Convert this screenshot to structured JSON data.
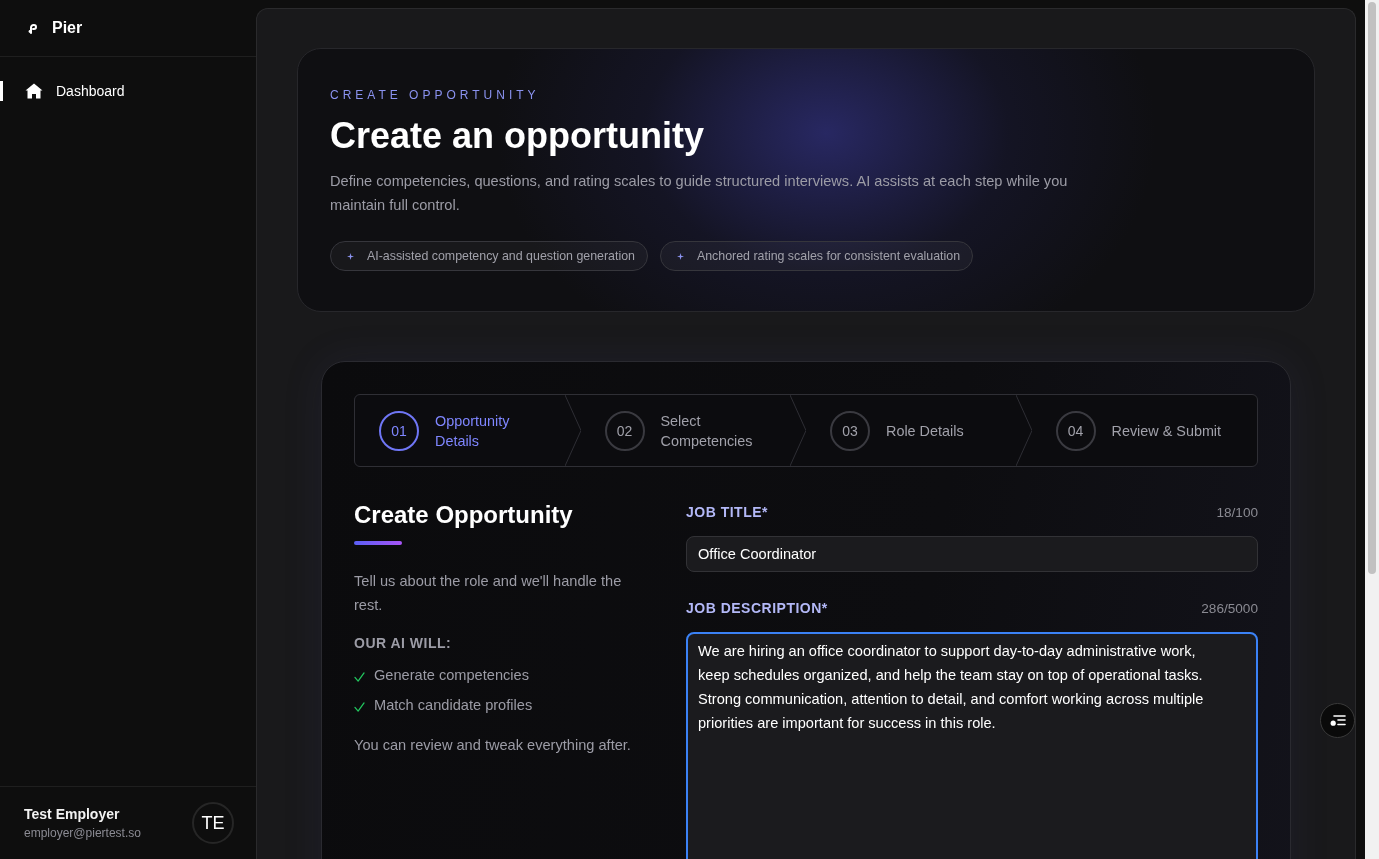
{
  "sidebar": {
    "brand": "Pier",
    "items": [
      {
        "label": "Dashboard",
        "selected": true
      }
    ],
    "user": {
      "name": "Test Employer",
      "email": "employer@piertest.so",
      "initials": "TE"
    }
  },
  "hero": {
    "eyebrow": "CREATE OPPORTUNITY",
    "title": "Create an opportunity",
    "description": "Define competencies, questions, and rating scales to guide structured interviews. AI assists at each step while you maintain full control.",
    "chips": [
      "AI-assisted competency and question generation",
      "Anchored rating scales for consistent evaluation"
    ]
  },
  "stepper": [
    {
      "number": "01",
      "label": "Opportunity Details",
      "selected": true
    },
    {
      "number": "02",
      "label": "Select Competencies",
      "selected": false
    },
    {
      "number": "03",
      "label": "Role Details",
      "selected": false
    },
    {
      "number": "04",
      "label": "Review & Submit",
      "selected": false
    }
  ],
  "intro": {
    "title": "Create Opportunity",
    "text": "Tell us about the role and we'll handle the rest.",
    "list_heading": "OUR AI WILL:",
    "list": [
      "Generate competencies",
      "Match candidate profiles"
    ],
    "note": "You can review and tweak everything after."
  },
  "fields": [
    {
      "kind": "input",
      "label": "JOB TITLE*",
      "counter": "18/100",
      "value": "Office Coordinator",
      "focused": false
    },
    {
      "kind": "textarea",
      "label": "JOB DESCRIPTION*",
      "counter": "286/5000",
      "value": "We are hiring an office coordinator to support day-to-day administrative work, keep schedules organized, and help the team stay on top of operational tasks. Strong communication, attention to detail, and comfort working across multiple priorities are important for success in this role.",
      "focused": true
    }
  ]
}
